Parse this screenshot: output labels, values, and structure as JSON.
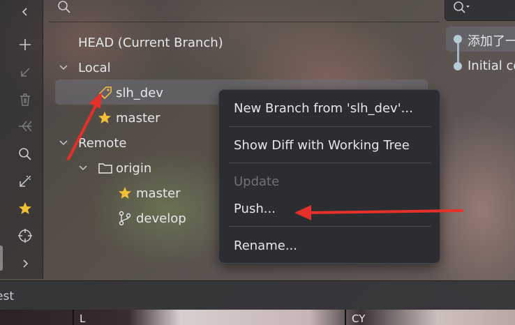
{
  "tree": {
    "head_label": "HEAD (Current Branch)",
    "local_label": "Local",
    "local_branches": [
      "slh_dev",
      "master"
    ],
    "remote_label": "Remote",
    "remote_name": "origin",
    "remote_branches": [
      "master",
      "develop"
    ]
  },
  "context_menu": {
    "new_branch": "New Branch from 'slh_dev'...",
    "show_diff": "Show Diff with Working Tree",
    "update": "Update",
    "push": "Push...",
    "rename": "Rename..."
  },
  "commits": [
    "添加了一",
    "Initial co"
  ],
  "status_text": "est",
  "bottom_labels": [
    "L",
    "CY"
  ],
  "colors": {
    "menu_bg": "#2b2d30",
    "selection": "#6e7078",
    "star": "#f2c037",
    "annotation_arrow": "#e8302a"
  },
  "icons": [
    "chevron-left-icon",
    "plus-icon",
    "arrow-down-left-icon",
    "trash-icon",
    "merge-arrows-icon",
    "search-icon",
    "compare-icon",
    "star-icon",
    "crosshair-icon",
    "chevron-right-icon",
    "tag-icon",
    "folder-icon",
    "branch-icon"
  ]
}
